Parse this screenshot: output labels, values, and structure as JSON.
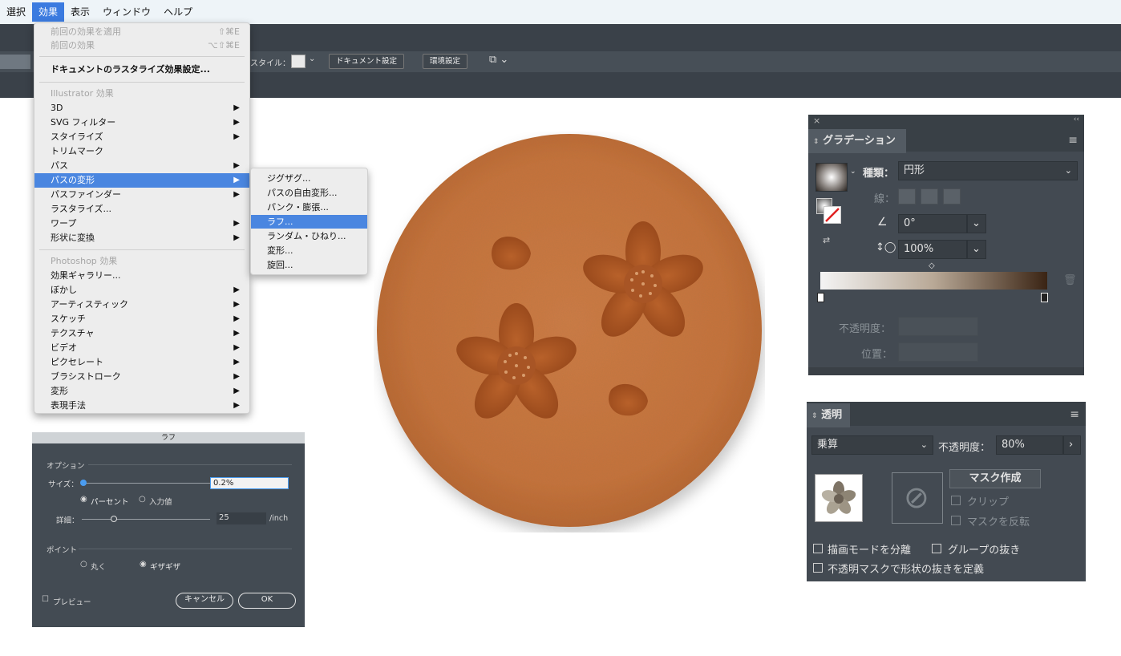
{
  "menubar": {
    "items": [
      "選択",
      "効果",
      "表示",
      "ウィンドウ",
      "ヘルプ"
    ]
  },
  "controlbar": {
    "style_label": "スタイル：",
    "doc_settings": "ドキュメント設定",
    "preferences": "環境設定"
  },
  "effect_menu": {
    "apply_last": "前回の効果を適用",
    "apply_last_shortcut": "⇧⌘E",
    "last_effect": "前回の効果",
    "last_effect_shortcut": "⌥⇧⌘E",
    "raster_settings": "ドキュメントのラスタライズ効果設定...",
    "illustrator_header": "Illustrator 効果",
    "illustrator_items": [
      "3D",
      "SVG フィルター",
      "スタイライズ",
      "トリムマーク",
      "パス",
      "パスの変形",
      "パスファインダー",
      "ラスタライズ...",
      "ワープ",
      "形状に変換"
    ],
    "photoshop_header": "Photoshop 効果",
    "photoshop_items": [
      "効果ギャラリー...",
      "ぼかし",
      "アーティスティック",
      "スケッチ",
      "テクスチャ",
      "ビデオ",
      "ピクセレート",
      "ブラシストローク",
      "変形",
      "表現手法"
    ]
  },
  "distort_submenu": {
    "items": [
      "ジグザグ...",
      "パスの自由変形...",
      "パンク・膨張...",
      "ラフ...",
      "ランダム・ひねり...",
      "変形...",
      "旋回..."
    ]
  },
  "roughen_dialog": {
    "title": "ラフ",
    "options_header": "オプション",
    "size_label": "サイズ：",
    "size_value": "0.2%",
    "percent_radio": "パーセント",
    "absolute_radio": "入力値",
    "detail_label": "詳細：",
    "detail_value": "25",
    "detail_unit": "/inch",
    "points_header": "ポイント",
    "smooth_radio": "丸く",
    "corner_radio": "ギザギザ",
    "preview_label": "プレビュー",
    "cancel": "キャンセル",
    "ok": "OK"
  },
  "gradient_panel": {
    "title": "グラデーション",
    "type_label": "種類：",
    "type_value": "円形",
    "stroke_label": "線：",
    "angle_value": "0°",
    "aspect_value": "100%",
    "opacity_label": "不透明度：",
    "location_label": "位置："
  },
  "transparency_panel": {
    "title": "透明",
    "blend_mode": "乗算",
    "opacity_label": "不透明度：",
    "opacity_value": "80%",
    "make_mask": "マスク作成",
    "clip": "クリップ",
    "invert_mask": "マスクを反転",
    "isolate_blending": "描画モードを分離",
    "knockout_group": "グループの抜き",
    "opacity_mask_shape": "不透明マスクで形状の抜きを定義"
  },
  "colors": {
    "menu_highlight": "#4a86e0",
    "panel_bg": "#434a52",
    "dorayaki": "#c9733d"
  }
}
